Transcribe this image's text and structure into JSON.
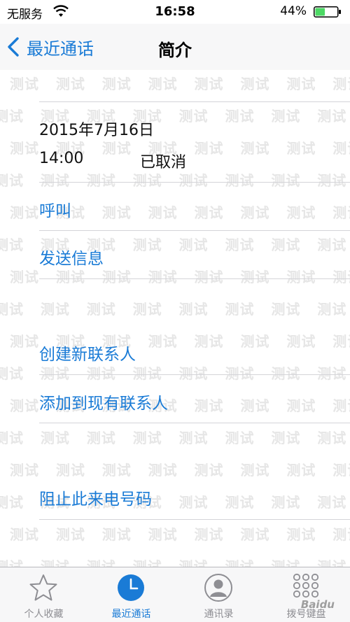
{
  "status_bar": {
    "carrier": "无服务",
    "time": "16:58",
    "battery_percent": "44%",
    "battery_level": 0.44,
    "battery_color": "#4cd964"
  },
  "nav": {
    "back_label": "最近通话",
    "title": "简介"
  },
  "call": {
    "date": "2015年7月16日",
    "time": "14:00",
    "status": "已取消"
  },
  "actions": {
    "call": "呼叫",
    "send_message": "发送信息",
    "create_contact": "创建新联系人",
    "add_to_existing": "添加到现有联系人",
    "block_caller": "阻止此来电号码"
  },
  "watermark": {
    "text": "测试"
  },
  "tab_bar": {
    "tabs": [
      {
        "label": "个人收藏",
        "icon": "star-icon",
        "active": false
      },
      {
        "label": "最近通话",
        "icon": "clock-icon",
        "active": true
      },
      {
        "label": "通讯录",
        "icon": "contacts-icon",
        "active": false
      },
      {
        "label": "拨号键盘",
        "icon": "keypad-icon",
        "active": false
      }
    ]
  },
  "colors": {
    "accent": "#1a7bd6",
    "inactive_tab": "#8e8e93"
  },
  "corner_watermark": "Baidu"
}
